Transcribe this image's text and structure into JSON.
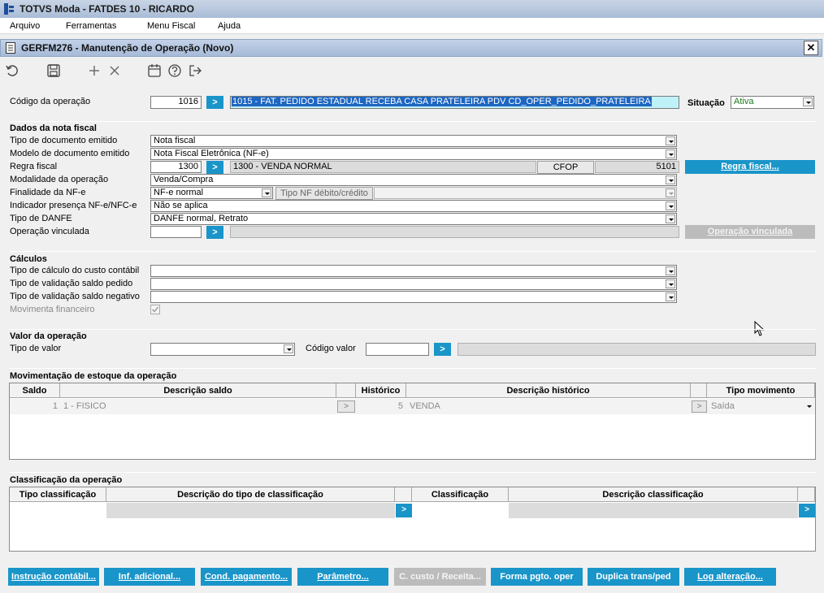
{
  "app": {
    "title": "TOTVS Moda - FATDES 10 - RICARDO"
  },
  "menu": {
    "items": [
      "Arquivo",
      "Ferramentas",
      "Menu Fiscal",
      "Ajuda"
    ]
  },
  "window": {
    "title": "GERFM276 - Manutenção de Operação (Novo)",
    "close": "✕"
  },
  "toolbar": {
    "icons": [
      "undo-icon",
      "save-icon",
      "add-icon",
      "delete-icon",
      "calendar-icon",
      "help-icon",
      "exit-icon"
    ]
  },
  "header": {
    "codigo_label": "Código da operação",
    "codigo_value": "1016",
    "descricao_value": "1015 - FAT. PEDIDO ESTADUAL RECEBA CASA PRATELEIRA PDV CD_OPER_PEDIDO_PRATELEIRA",
    "situacao_label": "Situação",
    "situacao_value": "Ativa",
    "situacao_color": "#1a7a1a"
  },
  "dados": {
    "title": "Dados da nota fiscal",
    "tipo_doc_label": "Tipo de documento emitido",
    "tipo_doc_value": "Nota fiscal",
    "modelo_label": "Modelo de documento emitido",
    "modelo_value": "Nota Fiscal Eletrônica (NF-e)",
    "regra_label": "Regra fiscal",
    "regra_code": "1300",
    "regra_desc": "1300 - VENDA NORMAL",
    "cfop_label": "CFOP",
    "cfop_value": "5101",
    "regra_button": "Regra fiscal...",
    "modalidade_label": "Modalidade da operação",
    "modalidade_value": "Venda/Compra",
    "finalidade_label": "Finalidade da NF-e",
    "finalidade_value": "NF-e normal",
    "tipo_nf_button": "Tipo NF débito/crédito",
    "indicador_label": "Indicador presença NF-e/NFC-e",
    "indicador_value": "Não se aplica",
    "danfe_label": "Tipo de DANFE",
    "danfe_value": "DANFE normal, Retrato",
    "vinculada_label": "Operação vinculada",
    "vinculada_button": "Operação vinculada"
  },
  "calculos": {
    "title": "Cálculos",
    "custo_label": "Tipo de cálculo do custo contábil",
    "saldo_pedido_label": "Tipo de validação saldo pedido",
    "saldo_negativo_label": "Tipo de validação saldo negativo",
    "movimenta_label": "Movimenta financeiro"
  },
  "valor": {
    "title": "Valor da operação",
    "tipo_label": "Tipo de valor",
    "codigo_label": "Código valor"
  },
  "estoque": {
    "title": "Movimentação de estoque da operação",
    "headers": [
      "Saldo",
      "Descrição saldo",
      "Histórico",
      "Descrição histórico",
      "Tipo movimento"
    ],
    "row": {
      "saldo": "1",
      "descricao_saldo": "1 - FISICO",
      "historico": "5",
      "descricao_historico": "VENDA",
      "tipo_movimento": "Saída"
    }
  },
  "classificacao": {
    "title": "Classificação da operação",
    "headers": [
      "Tipo classificação",
      "Descrição do tipo de classificação",
      "Classificação",
      "Descrição classificação"
    ]
  },
  "buttons": {
    "instrucao": "Instrução contábil...",
    "inf_adicional": "Inf. adicional...",
    "cond_pagamento": "Cond. pagamento...",
    "parametro": "Parâmetro...",
    "c_custo": "C. custo / Receita...",
    "forma_pgto": "Forma pgto. oper",
    "duplica": "Duplica trans/ped",
    "log": "Log alteração..."
  },
  "colors": {
    "accent": "#1a95c9",
    "selection": "#1d66c2",
    "field_highlight": "#bff2f8"
  }
}
